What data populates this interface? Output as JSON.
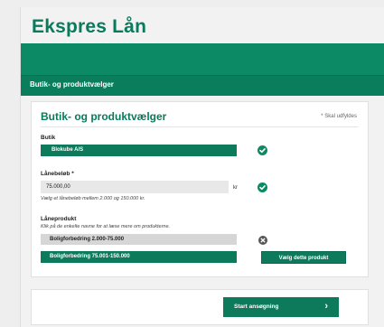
{
  "brand": "Ekspres Lån",
  "section_band": "Butik- og produktvælger",
  "card": {
    "title": "Butik- og produktvælger",
    "required_note": "* Skal udfyldes",
    "shop": {
      "label": "Butik",
      "value": "Blokube A/S"
    },
    "amount": {
      "label": "Lånebeløb *",
      "value": "75.000,00",
      "unit": "kr",
      "help": "Vælg et lånebeløb mellem 2.000 og 150.000 kr."
    },
    "product": {
      "label": "Låneprodukt",
      "help": "Klik på de enkelte navne for at læse mere om produkterne.",
      "options": [
        "Boligforbedring 2.000-75.000",
        "Boligforbedring 75.001-150.000"
      ],
      "choose_label": "Vælg dette produkt"
    }
  },
  "start": {
    "label": "Start ansøgning",
    "chevron": "›"
  },
  "colors": {
    "primary": "#0d7a5c",
    "brand_text": "#0a7a5c",
    "check": "#0b8a64"
  },
  "icons": [
    "check-circle-icon",
    "close-circle-icon",
    "chevron-right-icon"
  ]
}
